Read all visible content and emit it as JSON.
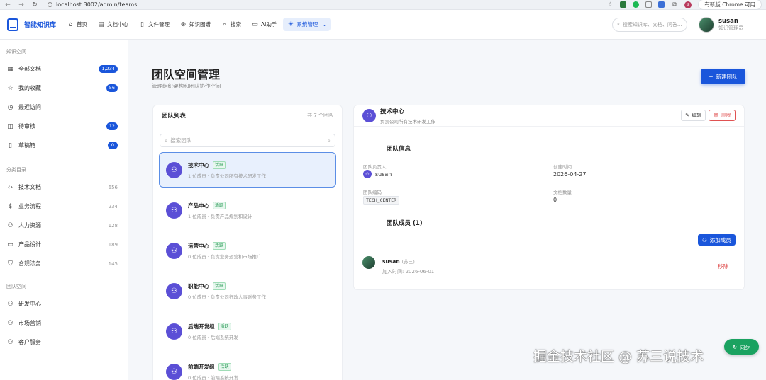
{
  "browser": {
    "url": "localhost:3002/admin/teams",
    "update_label": "有新版 Chrome 可用",
    "profile_initial": "s"
  },
  "header": {
    "app_name": "智能知识库",
    "nav": [
      {
        "label": "首页",
        "icon": "home-icon",
        "glyph": "⌂"
      },
      {
        "label": "文档中心",
        "icon": "document-icon",
        "glyph": "▤"
      },
      {
        "label": "文件管理",
        "icon": "file-icon",
        "glyph": "▯"
      },
      {
        "label": "知识图谱",
        "icon": "graph-icon",
        "glyph": "⊛"
      },
      {
        "label": "搜索",
        "icon": "search-icon",
        "glyph": "⌕"
      },
      {
        "label": "AI助手",
        "icon": "chat-icon",
        "glyph": "▭"
      },
      {
        "label": "系统管理",
        "icon": "settings-icon",
        "glyph": "✳",
        "active": true
      }
    ],
    "search_placeholder": "搜索知识库、文档、问答...",
    "user": {
      "name": "susan",
      "role": "知识管理员"
    }
  },
  "sidebar": {
    "section1_title": "知识空间",
    "section1": [
      {
        "label": "全部文档",
        "badge": "1,234",
        "glyph": "▦"
      },
      {
        "label": "我的收藏",
        "badge": "56",
        "glyph": "☆"
      },
      {
        "label": "最近访问",
        "glyph": "◷"
      },
      {
        "label": "待审核",
        "badge": "12",
        "glyph": "◫"
      },
      {
        "label": "草稿箱",
        "badge": "0",
        "glyph": "▯"
      }
    ],
    "section2_title": "分类目录",
    "section2": [
      {
        "label": "技术文档",
        "count": "656",
        "glyph": "‹›"
      },
      {
        "label": "业务流程",
        "count": "234",
        "glyph": "$"
      },
      {
        "label": "人力资源",
        "count": "128",
        "glyph": "⚇"
      },
      {
        "label": "产品设计",
        "count": "189",
        "glyph": "▭"
      },
      {
        "label": "合规法务",
        "count": "145",
        "glyph": "⛉"
      }
    ],
    "section3_title": "团队空间",
    "section3": [
      {
        "label": "研发中心",
        "glyph": "⚇"
      },
      {
        "label": "市场营销",
        "glyph": "⚇"
      },
      {
        "label": "客户服务",
        "glyph": "⚇"
      }
    ]
  },
  "page": {
    "title": "团队空间管理",
    "subtitle": "管理组织架构和团队协作空间",
    "new_button": "新建团队"
  },
  "team_list": {
    "title": "团队列表",
    "count": "共 7 个团队",
    "search_placeholder": "搜索团队",
    "teams": [
      {
        "name": "技术中心",
        "status": "活跃",
        "meta": "1 位成员 · 负责公司所有技术研发工作",
        "selected": true
      },
      {
        "name": "产品中心",
        "status": "活跃",
        "meta": "1 位成员 · 负责产品规划和设计"
      },
      {
        "name": "运营中心",
        "status": "活跃",
        "meta": "0 位成员 · 负责业务运营和市场推广"
      },
      {
        "name": "职能中心",
        "status": "活跃",
        "meta": "0 位成员 · 负责公司行政人事财务工作"
      },
      {
        "name": "后端开发组",
        "status": "活跃",
        "meta": "0 位成员 · 后端系统开发"
      },
      {
        "name": "前端开发组",
        "status": "活跃",
        "meta": "0 位成员 · 前端系统开发"
      }
    ]
  },
  "detail": {
    "name": "技术中心",
    "desc": "负责公司所有技术研发工作",
    "edit_label": "编辑",
    "delete_label": "删除",
    "info_title": "团队信息",
    "owner_label": "团队负责人",
    "owner_value": "susan",
    "created_label": "创建时间",
    "created_value": "2026-04-27",
    "code_label": "团队编码",
    "code_value": "TECH_CENTER",
    "docs_label": "文档数量",
    "docs_value": "0",
    "members_title": "团队成员 (1)",
    "add_member_label": "添加成员",
    "members": [
      {
        "name": "susan",
        "nickname": "(苏三)",
        "joined": "加入时间: 2026-06-01",
        "remove_label": "移除"
      }
    ]
  },
  "floating": {
    "sync_label": "同步",
    "watermark": "掘金技术社区 @ 苏三说技术"
  }
}
